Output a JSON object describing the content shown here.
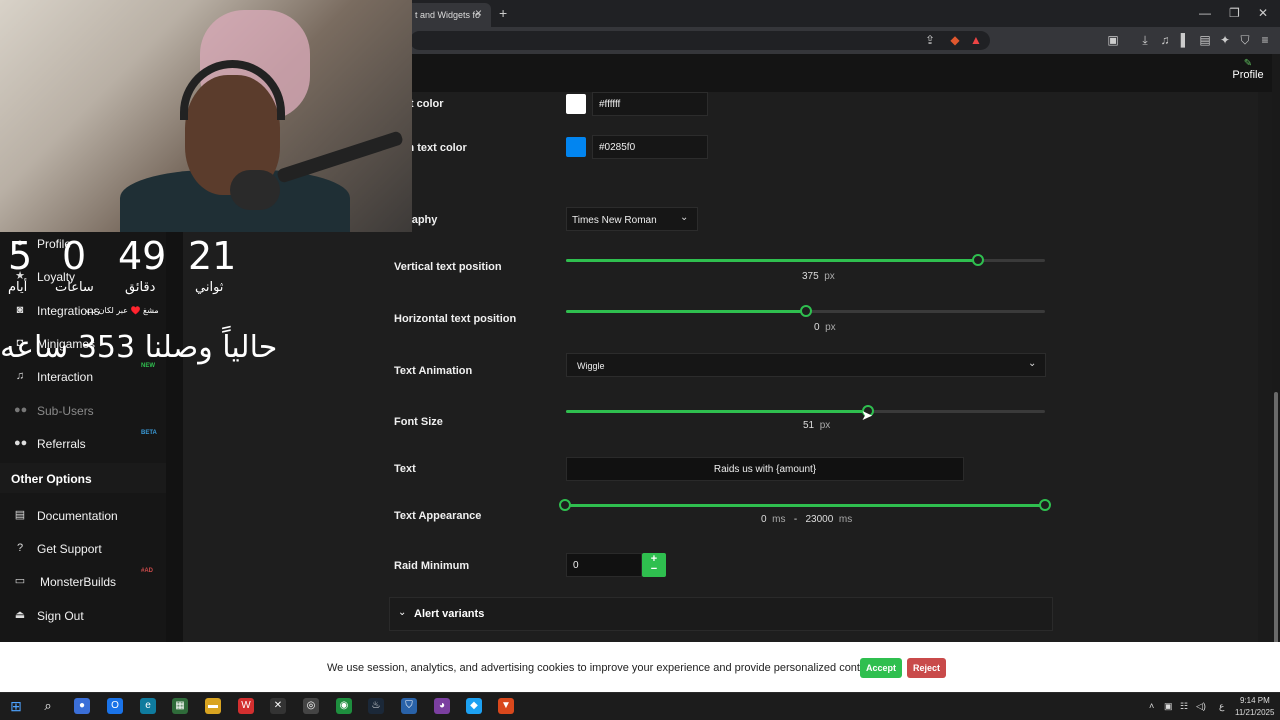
{
  "browser": {
    "tab_title": "t and Widgets fo",
    "tab_close": "×",
    "new_tab": "+",
    "min": "—",
    "restore": "❐",
    "close": "✕"
  },
  "header": {
    "profile_label": "Profile"
  },
  "sidebar": {
    "items": [
      {
        "label": "Profile",
        "icon": "user-icon"
      },
      {
        "label": "Loyalty",
        "icon": "star-icon"
      },
      {
        "label": "Integrations",
        "icon": "discord-icon"
      },
      {
        "label": "Minigames",
        "icon": "gamepad-icon"
      },
      {
        "label": "Interaction",
        "icon": "music-icon"
      },
      {
        "label": "Sub-Users",
        "icon": "users-icon"
      },
      {
        "label": "Referrals",
        "icon": "referrals-icon"
      }
    ],
    "interaction_badge": "NEW",
    "referrals_badge": "BETA",
    "other_options_title": "Other Options",
    "other_items": [
      {
        "label": "Documentation",
        "icon": "book-icon"
      },
      {
        "label": "Get Support",
        "icon": "help-icon"
      },
      {
        "label": "MonsterBuilds",
        "icon": "laptop-icon"
      },
      {
        "label": "Sign Out",
        "icon": "signout-icon"
      }
    ],
    "monsterbuilds_badge": "#AD"
  },
  "overlay": {
    "days": "5",
    "hours": "0",
    "minutes": "49",
    "seconds": "21",
    "days_label": "أيام",
    "hours_label": "ساعات",
    "minutes_label": "دقائق",
    "seconds_label": "ثواني",
    "sub_text": "مشغ ♥️ عبر لكان تب",
    "big_text": "حالياً وصلنا 353 ساعه"
  },
  "settings": {
    "text_color_label": "text color",
    "text_color_value": "#ffffff",
    "text_color_swatch": "#ffffff",
    "custom_text_color_label": "tom text color",
    "custom_text_color_value": "#0285f0",
    "custom_text_color_swatch": "#0285f0",
    "typography_label": "ography",
    "typography_value": "Times New Roman",
    "vertical_label": "Vertical text position",
    "vertical_value": "375",
    "vertical_fraction": 0.86,
    "horizontal_label": "Horizontal text position",
    "horizontal_value": "0",
    "horizontal_fraction": 0.5,
    "animation_label": "Text Animation",
    "animation_value": "Wiggle",
    "font_size_label": "Font Size",
    "font_size_value": "51",
    "font_size_fraction": 0.63,
    "text_label": "Text",
    "text_value": "Raids us with {amount}",
    "appearance_label": "Text Appearance",
    "appearance_min": "0",
    "appearance_max": "23000",
    "raid_min_label": "Raid Minimum",
    "raid_min_value": "0",
    "variants_label": "Alert variants",
    "unit_px": "px",
    "unit_ms": "ms",
    "dash": "-",
    "accent": "#2fbf4f"
  },
  "cookie": {
    "text": "We use session, analytics, and advertising cookies to improve your experience and provide personalized content",
    "accept": "Accept",
    "reject": "Reject"
  },
  "taskbar": {
    "time": "9:14 PM",
    "date": "11/21/2025",
    "lang": "ع"
  }
}
